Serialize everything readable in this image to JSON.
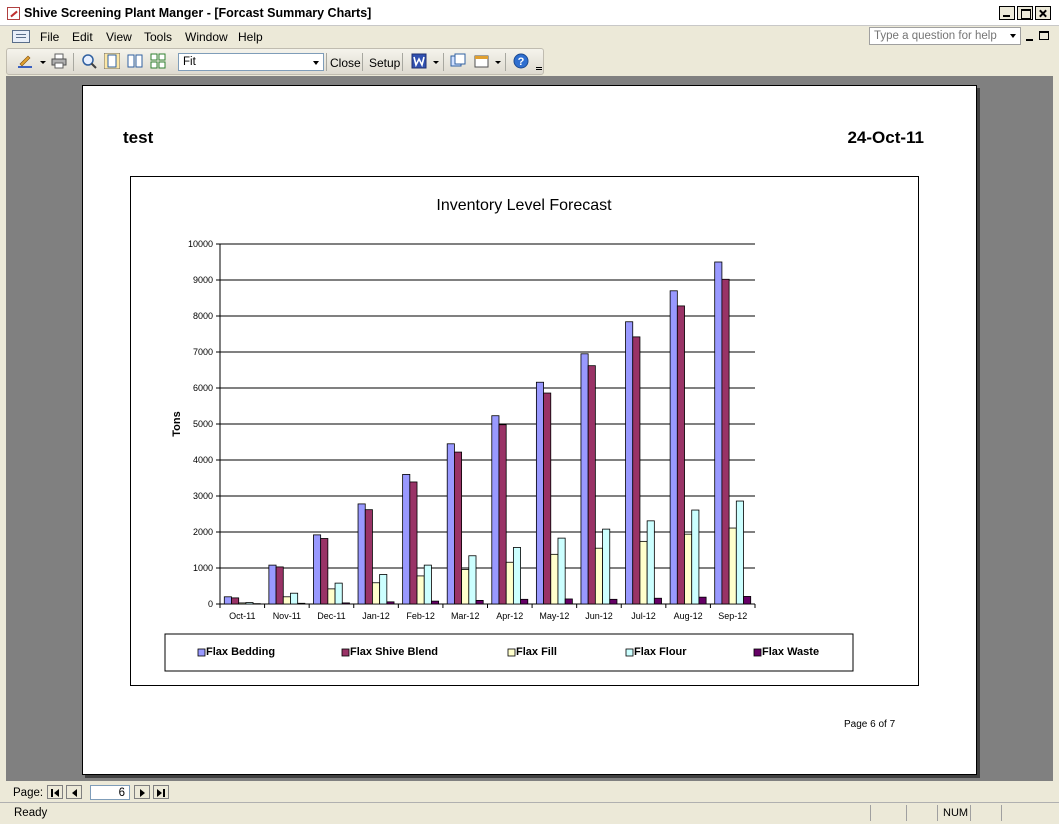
{
  "window": {
    "title": "Shive Screening Plant Manger - [Forcast Summary Charts]"
  },
  "menubar": {
    "items": [
      "File",
      "Edit",
      "View",
      "Tools",
      "Window",
      "Help"
    ],
    "help_placeholder": "Type a question for help"
  },
  "toolbar": {
    "zoom_value": "Fit",
    "close_label": "Close",
    "setup_label": "Setup",
    "icons": [
      "view-icon",
      "print-icon",
      "zoom-icon",
      "one-page-icon",
      "two-pages-icon",
      "multiple-pages-icon",
      "word-export-icon",
      "database-window-icon",
      "new-object-icon",
      "help-icon"
    ]
  },
  "report": {
    "title": "test",
    "date": "24-Oct-11",
    "page_footer": "Page 6 of 7"
  },
  "chart_data": {
    "type": "bar",
    "title": "Inventory Level Forecast",
    "xlabel": "",
    "ylabel": "Tons",
    "ylim": [
      0,
      10000
    ],
    "yticks": [
      0,
      1000,
      2000,
      3000,
      4000,
      5000,
      6000,
      7000,
      8000,
      9000,
      10000
    ],
    "grid": true,
    "legend_position": "bottom",
    "categories": [
      "Oct-11",
      "Nov-11",
      "Dec-11",
      "Jan-12",
      "Feb-12",
      "Mar-12",
      "Apr-12",
      "May-12",
      "Jun-12",
      "Jul-12",
      "Aug-12",
      "Sep-12"
    ],
    "series": [
      {
        "name": "Flax Bedding",
        "color": "#9999ff",
        "values": [
          200,
          1080,
          1920,
          2780,
          3600,
          4450,
          5230,
          6160,
          6950,
          7840,
          8700,
          9500
        ]
      },
      {
        "name": "Flax Shive Blend",
        "color": "#993366",
        "values": [
          170,
          1030,
          1820,
          2620,
          3390,
          4220,
          4980,
          5860,
          6620,
          7420,
          8280,
          9020
        ]
      },
      {
        "name": "Flax Fill",
        "color": "#ffffcc",
        "values": [
          30,
          200,
          420,
          590,
          780,
          960,
          1160,
          1380,
          1550,
          1740,
          1940,
          2110
        ]
      },
      {
        "name": "Flax Flour",
        "color": "#ccffff",
        "values": [
          40,
          300,
          580,
          820,
          1080,
          1340,
          1570,
          1830,
          2080,
          2310,
          2610,
          2860
        ]
      },
      {
        "name": "Flax Waste",
        "color": "#660066",
        "values": [
          10,
          20,
          30,
          60,
          80,
          100,
          130,
          140,
          130,
          160,
          190,
          210
        ]
      }
    ]
  },
  "navigation": {
    "page_label": "Page:",
    "current_page": "6"
  },
  "status": {
    "ready": "Ready",
    "num": "NUM"
  }
}
